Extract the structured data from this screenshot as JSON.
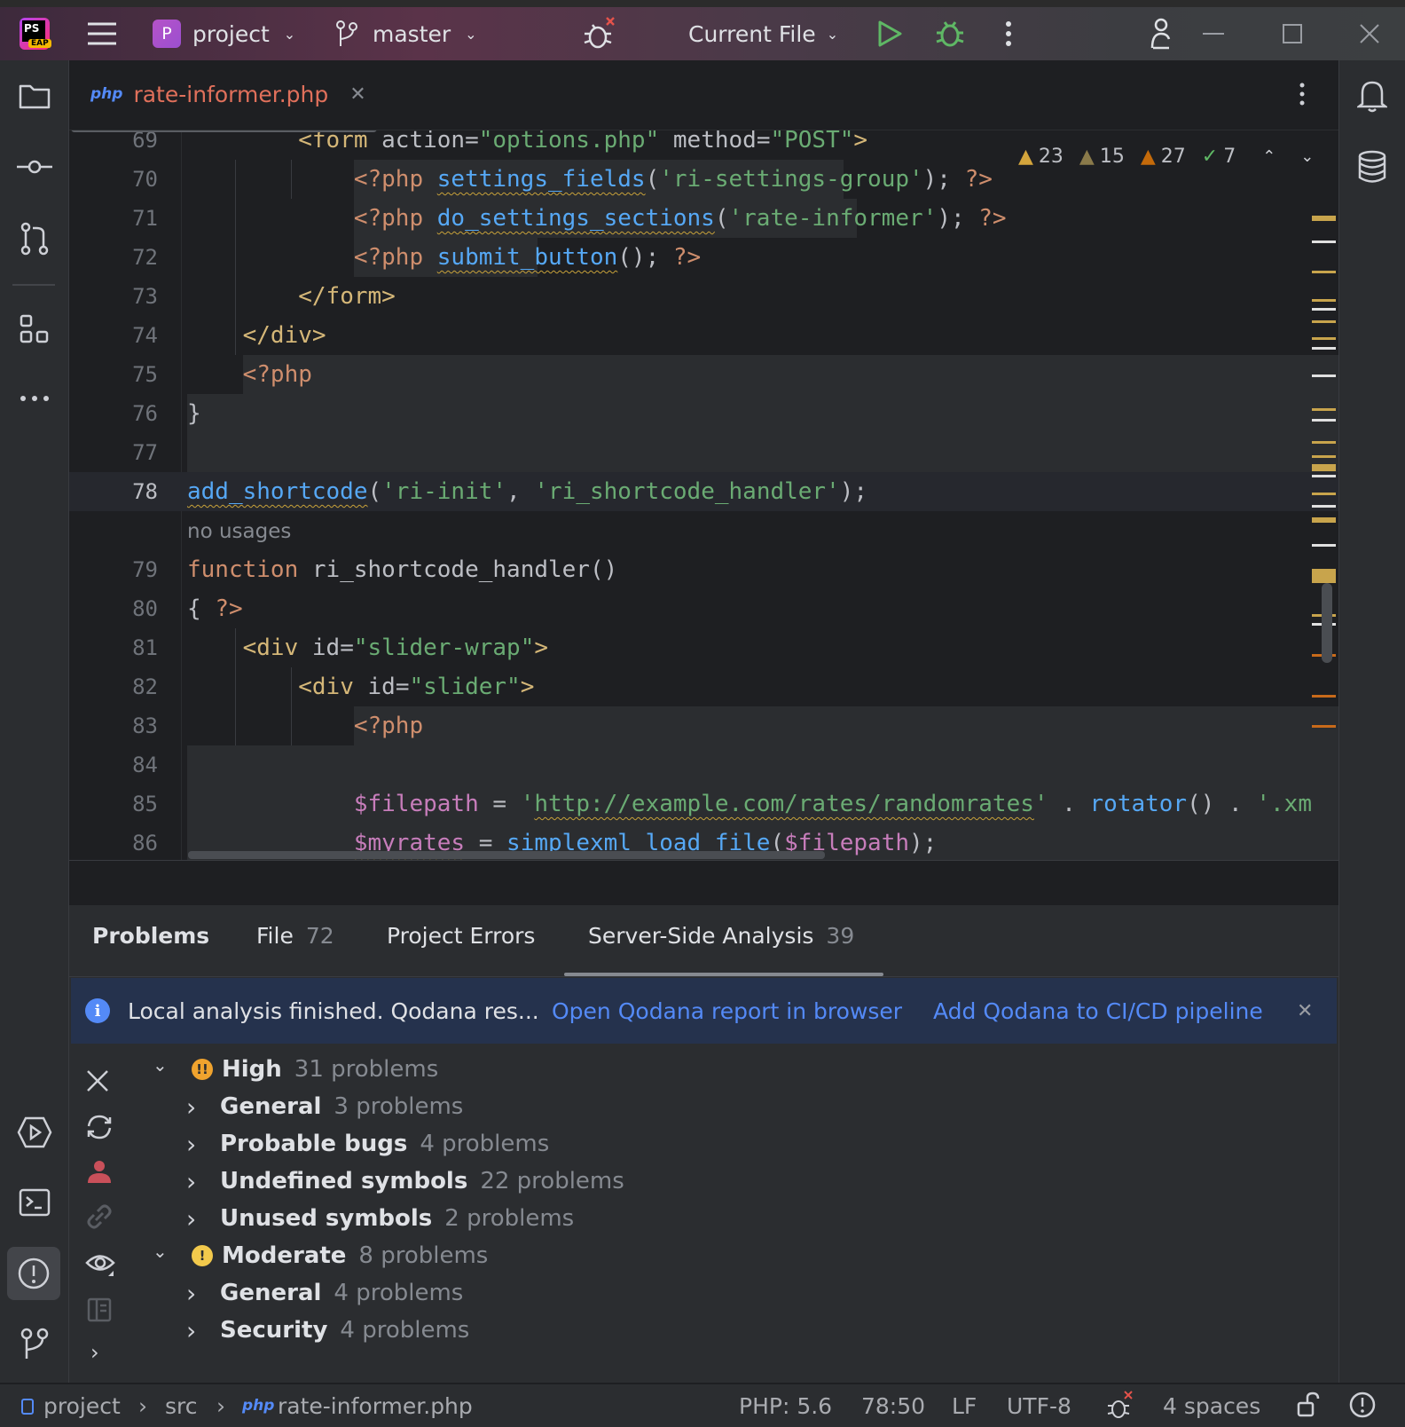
{
  "titlebar": {
    "app_icon_text": "PS",
    "app_badge": "EAP",
    "project_initial": "P",
    "project_name": "project",
    "branch_name": "master",
    "run_config": "Current File"
  },
  "tabs": [
    {
      "type_label": "php",
      "name": "rate-informer.php"
    }
  ],
  "inspections": {
    "warnings_a": "23",
    "warnings_b": "15",
    "warnings_c": "27",
    "typos": "7"
  },
  "editor": {
    "lines": [
      {
        "num": "69",
        "tokens": [
          [
            "        ",
            "d"
          ],
          [
            "<form ",
            "t"
          ],
          [
            "action",
            "a"
          ],
          [
            "=",
            "d"
          ],
          [
            "\"options.php\"",
            "s"
          ],
          [
            " method",
            "a"
          ],
          [
            "=",
            "d"
          ],
          [
            "\"POST\"",
            "s"
          ],
          [
            ">",
            "t"
          ]
        ]
      },
      {
        "num": "70",
        "tokens": [
          [
            "            ",
            "d"
          ],
          [
            "<?php ",
            "p"
          ],
          [
            "settings_fields",
            "f u"
          ],
          [
            "(",
            "d"
          ],
          [
            "'ri-settings-group'",
            "s"
          ],
          [
            "); ",
            "d"
          ],
          [
            "?>",
            "p"
          ]
        ]
      },
      {
        "num": "71",
        "tokens": [
          [
            "            ",
            "d"
          ],
          [
            "<?php ",
            "p"
          ],
          [
            "do_settings_sections",
            "f u"
          ],
          [
            "(",
            "d"
          ],
          [
            "'rate-informer'",
            "s"
          ],
          [
            "); ",
            "d"
          ],
          [
            "?>",
            "p"
          ]
        ]
      },
      {
        "num": "72",
        "tokens": [
          [
            "            ",
            "d"
          ],
          [
            "<?php ",
            "p"
          ],
          [
            "submit_button",
            "f u"
          ],
          [
            "(); ",
            "d"
          ],
          [
            "?>",
            "p"
          ]
        ]
      },
      {
        "num": "73",
        "tokens": [
          [
            "        ",
            "d"
          ],
          [
            "</form>",
            "t"
          ]
        ]
      },
      {
        "num": "74",
        "tokens": [
          [
            "    ",
            "d"
          ],
          [
            "</div>",
            "t"
          ]
        ]
      },
      {
        "num": "75",
        "tokens": [
          [
            "    ",
            "d"
          ],
          [
            "<?php",
            "p"
          ]
        ]
      },
      {
        "num": "76",
        "tokens": [
          [
            "}",
            "d"
          ]
        ]
      },
      {
        "num": "77",
        "tokens": []
      },
      {
        "num": "78",
        "tokens": [
          [
            "add_shortcode",
            "f u"
          ],
          [
            "(",
            "d"
          ],
          [
            "'ri-init'",
            "s"
          ],
          [
            ", ",
            "d"
          ],
          [
            "'ri_shortcode_handler'",
            "s"
          ],
          [
            ");",
            "d"
          ]
        ]
      },
      {
        "num": "",
        "tokens": [
          [
            "no usages",
            "g"
          ]
        ]
      },
      {
        "num": "79",
        "tokens": [
          [
            "function ",
            "k"
          ],
          [
            "ri_shortcode_handler",
            "n"
          ],
          [
            "()",
            "d"
          ]
        ]
      },
      {
        "num": "80",
        "tokens": [
          [
            "{ ",
            "d"
          ],
          [
            "?>",
            "p"
          ]
        ]
      },
      {
        "num": "81",
        "tokens": [
          [
            "    ",
            "d"
          ],
          [
            "<div ",
            "t"
          ],
          [
            "id",
            "a"
          ],
          [
            "=",
            "d"
          ],
          [
            "\"slider-wrap\"",
            "s"
          ],
          [
            ">",
            "t"
          ]
        ]
      },
      {
        "num": "82",
        "tokens": [
          [
            "        ",
            "d"
          ],
          [
            "<div ",
            "t"
          ],
          [
            "id",
            "a"
          ],
          [
            "=",
            "d"
          ],
          [
            "\"slider\"",
            "s"
          ],
          [
            ">",
            "t"
          ]
        ]
      },
      {
        "num": "83",
        "tokens": [
          [
            "            ",
            "d"
          ],
          [
            "<?php",
            "p"
          ]
        ]
      },
      {
        "num": "84",
        "tokens": []
      },
      {
        "num": "85",
        "tokens": [
          [
            "            ",
            "d"
          ],
          [
            "$filepath",
            "v"
          ],
          [
            " = ",
            "d"
          ],
          [
            "'",
            "s"
          ],
          [
            "http://example.com/rates/randomrates",
            "s u"
          ],
          [
            "'",
            "s"
          ],
          [
            " . ",
            "d"
          ],
          [
            "rotator",
            "f"
          ],
          [
            "() . ",
            "d"
          ],
          [
            "'.xm",
            "s"
          ]
        ]
      },
      {
        "num": "86",
        "tokens": [
          [
            "            ",
            "d"
          ],
          [
            "$myrates",
            "v u"
          ],
          [
            " = ",
            "d"
          ],
          [
            "simplexml_load_file",
            "f"
          ],
          [
            "(",
            "d"
          ],
          [
            "$filepath",
            "v"
          ],
          [
            ");",
            "d"
          ]
        ]
      }
    ]
  },
  "problems": {
    "tabs": [
      {
        "label": "Problems",
        "count": ""
      },
      {
        "label": "File",
        "count": "72"
      },
      {
        "label": "Project Errors",
        "count": ""
      },
      {
        "label": "Server-Side Analysis",
        "count": "39"
      }
    ],
    "banner": {
      "text": "Local analysis finished. Qodana res...",
      "link1": "Open Qodana report in browser",
      "link2": "Add Qodana to CI/CD pipeline"
    },
    "tree": [
      {
        "label": "High",
        "count": "31 problems",
        "level": 0,
        "severity": "high"
      },
      {
        "label": "General",
        "count": "3 problems",
        "level": 1
      },
      {
        "label": "Probable bugs",
        "count": "4 problems",
        "level": 1
      },
      {
        "label": "Undefined symbols",
        "count": "22 problems",
        "level": 1
      },
      {
        "label": "Unused symbols",
        "count": "2 problems",
        "level": 1
      },
      {
        "label": "Moderate",
        "count": "8 problems",
        "level": 0,
        "severity": "moderate"
      },
      {
        "label": "General",
        "count": "4 problems",
        "level": 1
      },
      {
        "label": "Security",
        "count": "4 problems",
        "level": 1
      }
    ]
  },
  "statusbar": {
    "project": "project",
    "src": "src",
    "file_type": "php",
    "file": "rate-informer.php",
    "php_version": "PHP: 5.6",
    "position": "78:50",
    "line_ending": "LF",
    "encoding": "UTF-8",
    "indent": "4 spaces"
  },
  "colors": {
    "accent": "#548af7",
    "error_tab": "#e0705b",
    "high": "#f0a32e",
    "moderate": "#f2c94c"
  }
}
